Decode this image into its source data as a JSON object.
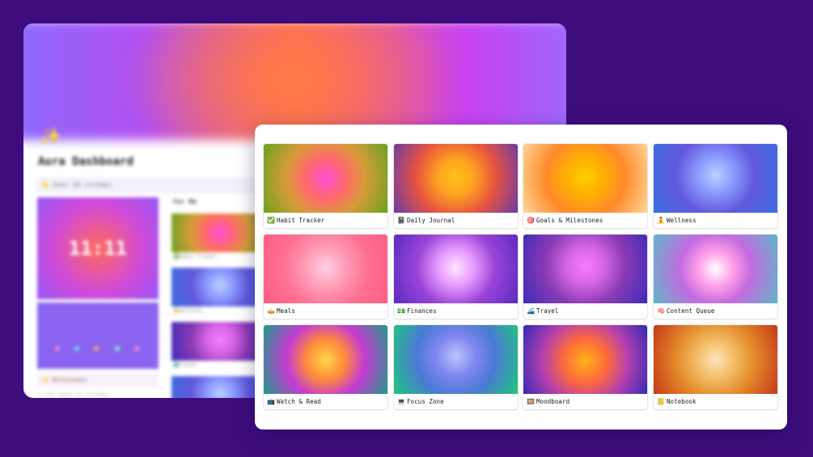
{
  "background": {
    "color": "#3d0d7d"
  },
  "back_window": {
    "title": "Aura Dashboard",
    "cover_emoji": "✨",
    "quote": "⭐ Over 40 streaks",
    "clock": "11:11",
    "section_for_me": "For Me",
    "thumb_labels": [
      "✅Habit Tracker",
      "🧘Wellness",
      "🌍Travel"
    ],
    "milestone": "⭐ Milestones",
    "milestone_sub": "• 111 days of streaks"
  },
  "gallery": {
    "cards": [
      {
        "emoji": "✅",
        "title": "Habit Tracker"
      },
      {
        "emoji": "📓",
        "title": "Daily Journal"
      },
      {
        "emoji": "🎯",
        "title": "Goals & Milestones"
      },
      {
        "emoji": "🧘",
        "title": "Wellness"
      },
      {
        "emoji": "🥧",
        "title": "Meals"
      },
      {
        "emoji": "💵",
        "title": "Finances"
      },
      {
        "emoji": "🚄",
        "title": "Travel"
      },
      {
        "emoji": "🧠",
        "title": "Content Queue"
      },
      {
        "emoji": "📺",
        "title": "Watch & Read"
      },
      {
        "emoji": "💻",
        "title": "Focus Zone"
      },
      {
        "emoji": "🎞️",
        "title": "Moodboard"
      },
      {
        "emoji": "📒",
        "title": "Notebook"
      }
    ]
  }
}
